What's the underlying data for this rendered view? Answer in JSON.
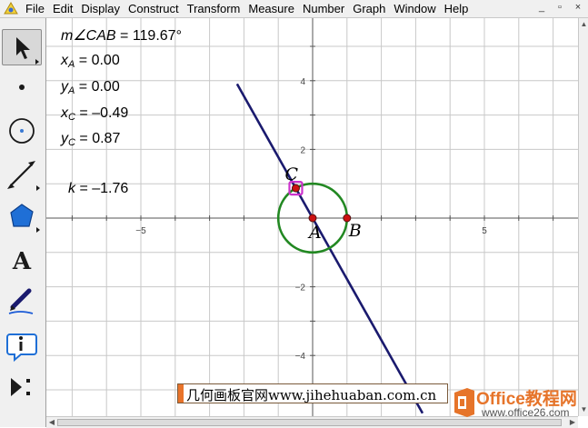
{
  "menubar": {
    "items": [
      "File",
      "Edit",
      "Display",
      "Construct",
      "Transform",
      "Measure",
      "Number",
      "Graph",
      "Window",
      "Help"
    ],
    "window_buttons": [
      "_",
      "▫",
      "×"
    ]
  },
  "toolbox": {
    "tools": [
      "selection-arrow-tool",
      "point-tool",
      "compass-tool",
      "straightedge-tool",
      "polygon-tool",
      "text-tool",
      "marker-tool",
      "information-tool",
      "custom-tools"
    ]
  },
  "measurements": {
    "angle": {
      "prefix": "m∠",
      "name": "CAB",
      "value": "= 119.67°"
    },
    "xA": {
      "var": "x",
      "sub": "A",
      "value": "= 0.00"
    },
    "yA": {
      "var": "y",
      "sub": "A",
      "value": "= 0.00"
    },
    "xC": {
      "var": "x",
      "sub": "C",
      "value": "= –0.49"
    },
    "yC": {
      "var": "y",
      "sub": "C",
      "value": "= 0.87"
    },
    "k": {
      "var": "k",
      "value": "= –1.76"
    }
  },
  "graph": {
    "x_ticks": [
      "−5",
      "5"
    ],
    "y_ticks": [
      "4",
      "2",
      "−2",
      "−4"
    ],
    "point_labels": {
      "A": "A",
      "B": "B",
      "C": "C"
    },
    "colors": {
      "grid": "#c8c8c8",
      "axis": "#555555",
      "line": "#1a1a6e",
      "circle": "#228822",
      "point": "#cc1111",
      "selection": "#cc33cc"
    }
  },
  "watermarks": {
    "site": "几何画板官网www.jihehuaban.com.cn",
    "office_brand": "Office教程网",
    "office_url": "www.office26.com"
  }
}
